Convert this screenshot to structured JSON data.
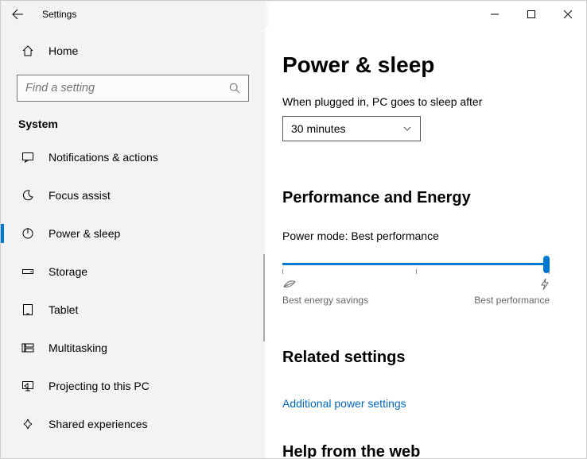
{
  "window": {
    "title": "Settings"
  },
  "sidebar": {
    "home_label": "Home",
    "search_placeholder": "Find a setting",
    "section": "System",
    "items": [
      {
        "label": "Notifications & actions"
      },
      {
        "label": "Focus assist"
      },
      {
        "label": "Power & sleep"
      },
      {
        "label": "Storage"
      },
      {
        "label": "Tablet"
      },
      {
        "label": "Multitasking"
      },
      {
        "label": "Projecting to this PC"
      },
      {
        "label": "Shared experiences"
      }
    ]
  },
  "content": {
    "title": "Power & sleep",
    "sleep_label": "When plugged in, PC goes to sleep after",
    "sleep_value": "30 minutes",
    "perf_heading": "Performance and Energy",
    "power_mode_label": "Power mode: Best performance",
    "slider_left_label": "Best energy savings",
    "slider_right_label": "Best performance",
    "related_heading": "Related settings",
    "related_link": "Additional power settings",
    "help_heading": "Help from the web"
  }
}
